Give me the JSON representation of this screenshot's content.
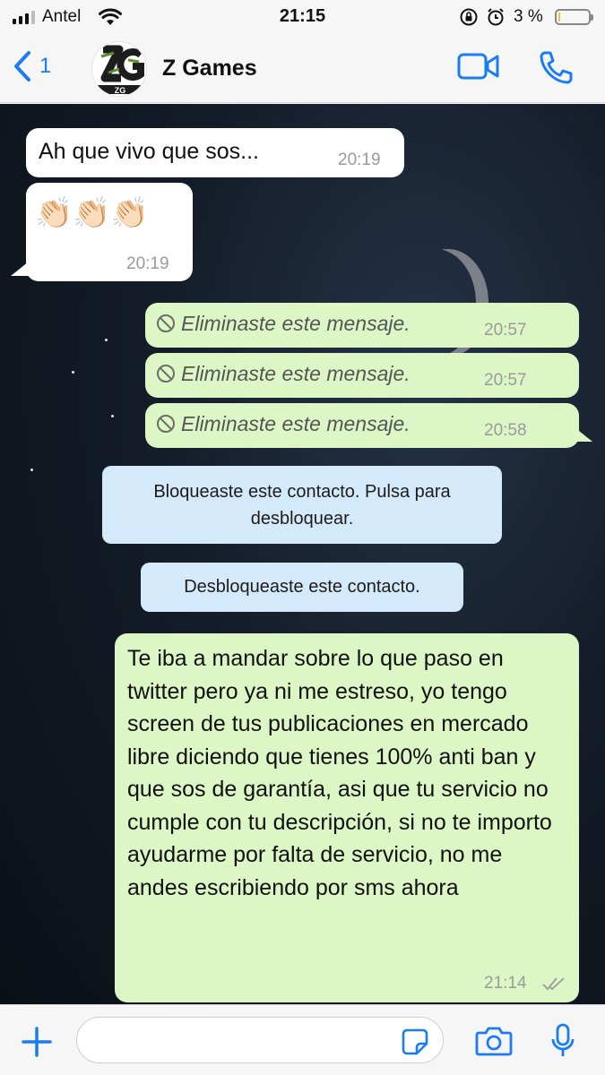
{
  "status_bar": {
    "carrier": "Antel",
    "time": "21:15",
    "battery_percent": "3 %",
    "battery_level": 0.03
  },
  "header": {
    "back_count": "1",
    "contact_name": "Z Games",
    "avatar_text": "ZG"
  },
  "messages": [
    {
      "type": "incoming",
      "text": "Ah que vivo que sos...",
      "time": "20:19"
    },
    {
      "type": "incoming",
      "text": "👏🏻👏🏻👏🏻",
      "time": "20:19"
    },
    {
      "type": "outgoing-deleted",
      "text": "Eliminaste este mensaje.",
      "time": "20:57"
    },
    {
      "type": "outgoing-deleted",
      "text": "Eliminaste este mensaje.",
      "time": "20:57"
    },
    {
      "type": "outgoing-deleted",
      "text": "Eliminaste este mensaje.",
      "time": "20:58"
    },
    {
      "type": "system",
      "text": "Bloqueaste este contacto. Pulsa para desbloquear."
    },
    {
      "type": "system",
      "text": "Desbloqueaste este contacto."
    },
    {
      "type": "outgoing",
      "text": "Te iba a mandar sobre lo que paso en twitter pero ya ni me estreso, yo tengo screen de tus publicaciones en mercado libre diciendo que tienes 100% anti ban y que sos de garantía, asi que tu servicio no cumple con tu descripción, si no te importo ayudarme por falta de servicio, no me andes escribiendo por sms ahora",
      "time": "21:14",
      "status": "read"
    }
  ],
  "input": {
    "value": "",
    "placeholder": ""
  },
  "colors": {
    "accent": "#1a7cf5",
    "outgoing_bubble": "#dcf7c5",
    "incoming_bubble": "#ffffff",
    "system_bubble": "#d4e9f9",
    "battery_low": "#f2c233"
  },
  "icons": [
    "chevron-left-icon",
    "video-camera-icon",
    "phone-icon",
    "plus-icon",
    "sticker-icon",
    "camera-icon",
    "microphone-icon",
    "blocked-icon",
    "double-check-icon",
    "wifi-icon",
    "alarm-icon",
    "rotation-lock-icon"
  ]
}
